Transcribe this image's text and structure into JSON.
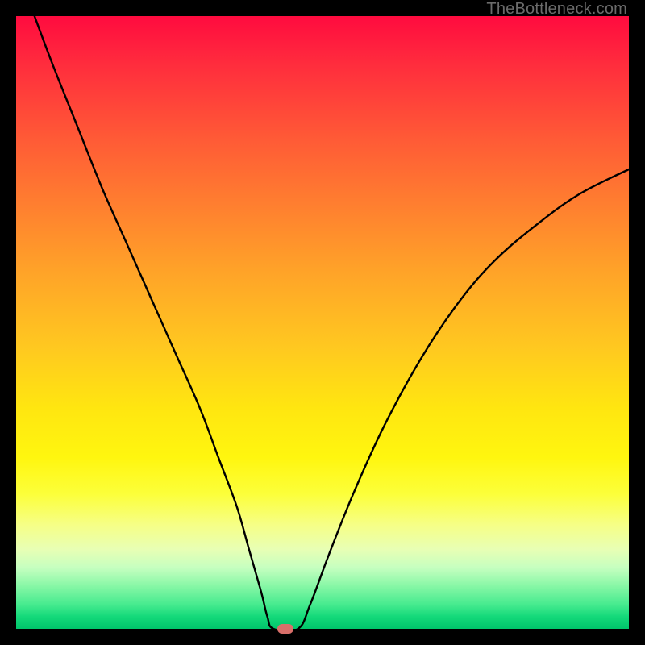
{
  "watermark": "TheBottleneck.com",
  "chart_data": {
    "type": "line",
    "title": "",
    "xlabel": "",
    "ylabel": "",
    "ylim": [
      0,
      100
    ],
    "xlim": [
      0,
      100
    ],
    "marker": {
      "x": 44,
      "y": 0
    },
    "series": [
      {
        "name": "curve",
        "x": [
          3,
          6,
          10,
          14,
          18,
          22,
          26,
          30,
          33,
          36,
          38,
          40,
          41,
          42,
          46,
          48,
          51,
          55,
          60,
          66,
          72,
          78,
          85,
          92,
          100
        ],
        "y": [
          100,
          92,
          82,
          72,
          63,
          54,
          45,
          36,
          28,
          20,
          13,
          6,
          2,
          0,
          0,
          4,
          12,
          22,
          33,
          44,
          53,
          60,
          66,
          71,
          75
        ]
      }
    ]
  }
}
